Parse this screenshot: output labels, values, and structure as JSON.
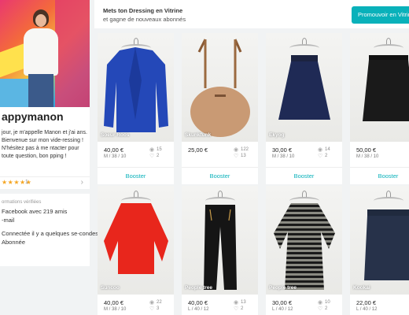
{
  "profile": {
    "username": "appymanon",
    "bio": "jour, je m'appelle Manon et j'ai ans. Bienvenue sur mon vide-ressing ! N'hésitez pas à me ntacter pour toute question, bon pping !",
    "stars": "★★★★★",
    "rating_count": "1",
    "chevron": "›",
    "verified_label": "ormations vérifiées",
    "facebook": "Facebook avec 219 amis",
    "email": "-mail",
    "connected": "Connectée il y a quelques se-condes",
    "subscribers": "Abonnée"
  },
  "banner": {
    "title": "Mets ton Dressing en Vitrine",
    "subtitle": "et gagne de nouveaux abonnés",
    "button": "Promouvoir en Vitrine"
  },
  "items": [
    {
      "brand": "Soeur Roos",
      "price": "40,00 €",
      "size": "M / 38 / 10",
      "views": "15",
      "favs": "2",
      "boost": "Booster"
    },
    {
      "brand": "Skunkfunk",
      "price": "25,00 €",
      "size": "",
      "views": "122",
      "favs": "13",
      "boost": "Booster"
    },
    {
      "brand": "Ekyog",
      "price": "30,00 €",
      "size": "M / 38 / 10",
      "views": "14",
      "favs": "2",
      "boost": "Booster"
    },
    {
      "brand": "",
      "price": "50,00 €",
      "size": "M / 38 / 10",
      "views": "",
      "favs": "",
      "boost": "Booster"
    },
    {
      "brand": "Suncoo",
      "price": "40,00 €",
      "size": "M / 38 / 10",
      "views": "22",
      "favs": "3",
      "boost": ""
    },
    {
      "brand": "People tree",
      "price": "40,00 €",
      "size": "L / 40 / 12",
      "views": "13",
      "favs": "2",
      "boost": ""
    },
    {
      "brand": "People tree",
      "price": "30,00 €",
      "size": "L / 40 / 12",
      "views": "10",
      "favs": "2",
      "boost": ""
    },
    {
      "brand": "Kookai",
      "price": "22,00 €",
      "size": "L / 40 / 12",
      "views": "",
      "favs": "",
      "boost": ""
    }
  ],
  "icons": {
    "views": "eye-icon",
    "favs": "heart-icon"
  },
  "colors": {
    "accent": "#09b1ba"
  }
}
